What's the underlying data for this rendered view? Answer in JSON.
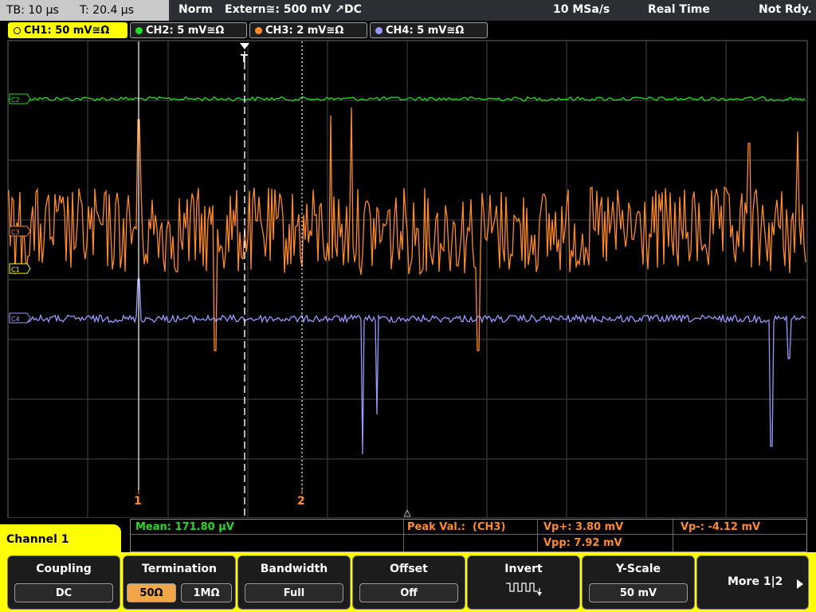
{
  "status": {
    "timebase": "TB: 10 µs",
    "trigger_time": "T: 20.4 µs",
    "mode": "Norm",
    "trigger_source": "Extern≅: 500 mV ↗DC",
    "sample_rate": "10 MSa/s",
    "acq_mode": "Real Time",
    "state": "Not Rdy."
  },
  "channels": [
    {
      "label": "CH1: 50 mV≅Ω",
      "color": "#ffff00"
    },
    {
      "label": "CH2: 5 mV≅Ω",
      "color": "#22dd22"
    },
    {
      "label": "CH3: 2 mV≅Ω",
      "color": "#ff8a2a"
    },
    {
      "label": "CH4: 5 mV≅Ω",
      "color": "#9999ff"
    }
  ],
  "markers": {
    "ch2": "C2",
    "ch3": "C3",
    "ch1": "C1",
    "ch4": "C4",
    "trigger": "T",
    "cursor1": "1",
    "cursor2": "2"
  },
  "measurements": {
    "mean": "Mean: 171.80 µV",
    "peak": "Peak Val.:  (CH3)",
    "vp_plus": "Vp+: 3.80 mV",
    "vp_minus": "Vp-: -4.12 mV",
    "vpp": "Vpp: 7.92 mV"
  },
  "panel_title": "Channel 1",
  "softkeys": {
    "coupling": {
      "title": "Coupling",
      "value": "DC"
    },
    "termination": {
      "title": "Termination",
      "opt1": "50Ω",
      "opt2": "1MΩ"
    },
    "bandwidth": {
      "title": "Bandwidth",
      "value": "Full"
    },
    "offset": {
      "title": "Offset",
      "value": "Off"
    },
    "invert": {
      "title": "Invert"
    },
    "yscale": {
      "title": "Y-Scale",
      "value": "50 mV"
    },
    "more": {
      "label": "More 1|2"
    }
  }
}
